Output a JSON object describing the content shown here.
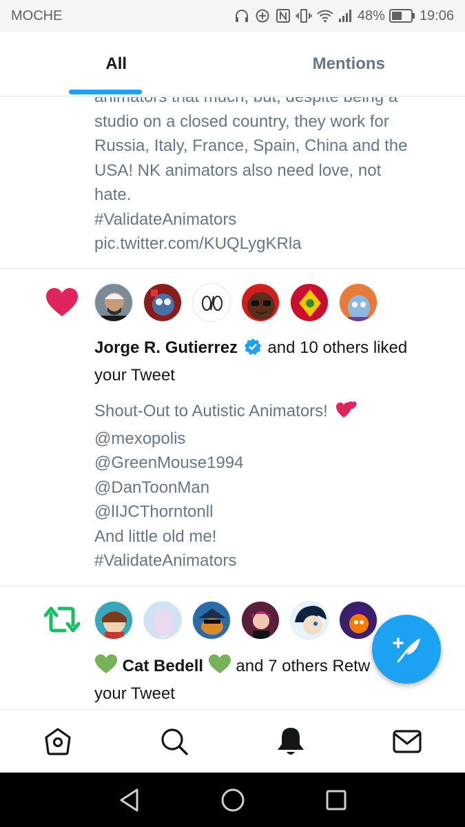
{
  "status_bar": {
    "carrier": "MOCHE",
    "battery": "48%",
    "time": "19:06",
    "icons": [
      "headphones-icon",
      "data-saver-icon",
      "nfc-icon",
      "vibrate-icon",
      "wifi-icon",
      "signal-icon",
      "battery-icon"
    ]
  },
  "tabs": [
    {
      "label": "All",
      "active": true
    },
    {
      "label": "Mentions",
      "active": false
    }
  ],
  "feed": {
    "first_tweet_lines": [
      "animators that much, but, despite being a",
      "studio on a closed country, they work for",
      "Russia, Italy, France, Spain, China and the",
      "USA! NK animators also need love, not",
      "hate.",
      "#ValidateAnimators",
      "pic.twitter.com/KUQLygKRla"
    ],
    "like_notification": {
      "icon": "heart-icon",
      "user": "Jorge R. Gutierrez",
      "verified": true,
      "action_text": "and 10 others liked",
      "action_text_2": "your Tweet",
      "tweet_line_1": "Shout-Out to Autistic Animators!",
      "tweet_lines": [
        "@mexopolis",
        "@GreenMouse1994",
        "@DanToonMan",
        "@lIJCThorntonll",
        "And little old me!",
        "#ValidateAnimators"
      ]
    },
    "retweet_notification": {
      "icon": "retweet-icon",
      "user": "Cat Bedell",
      "action_text": "and 7 others Retw",
      "action_text_2": "your Tweet"
    }
  },
  "fab": {
    "icon": "compose-tweet-icon"
  },
  "bottom_nav": [
    "home-icon",
    "search-icon",
    "notifications-icon",
    "messages-icon"
  ],
  "system_nav": [
    "back-icon",
    "home-circle-icon",
    "recents-icon"
  ],
  "colors": {
    "accent": "#1da1f2",
    "like": "#e0245e",
    "retweet": "#17bf63",
    "muted_text": "#657786"
  }
}
